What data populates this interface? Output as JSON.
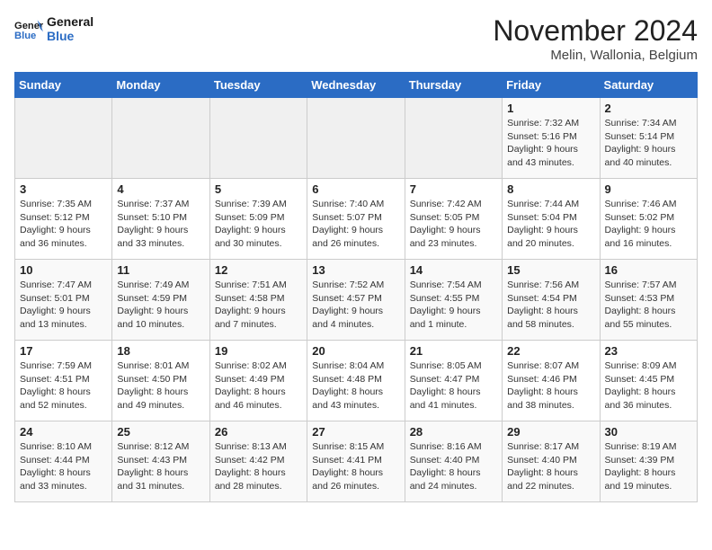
{
  "header": {
    "logo_line1": "General",
    "logo_line2": "Blue",
    "month_title": "November 2024",
    "location": "Melin, Wallonia, Belgium"
  },
  "weekdays": [
    "Sunday",
    "Monday",
    "Tuesday",
    "Wednesday",
    "Thursday",
    "Friday",
    "Saturday"
  ],
  "weeks": [
    [
      {
        "day": "",
        "info": ""
      },
      {
        "day": "",
        "info": ""
      },
      {
        "day": "",
        "info": ""
      },
      {
        "day": "",
        "info": ""
      },
      {
        "day": "",
        "info": ""
      },
      {
        "day": "1",
        "info": "Sunrise: 7:32 AM\nSunset: 5:16 PM\nDaylight: 9 hours and 43 minutes."
      },
      {
        "day": "2",
        "info": "Sunrise: 7:34 AM\nSunset: 5:14 PM\nDaylight: 9 hours and 40 minutes."
      }
    ],
    [
      {
        "day": "3",
        "info": "Sunrise: 7:35 AM\nSunset: 5:12 PM\nDaylight: 9 hours and 36 minutes."
      },
      {
        "day": "4",
        "info": "Sunrise: 7:37 AM\nSunset: 5:10 PM\nDaylight: 9 hours and 33 minutes."
      },
      {
        "day": "5",
        "info": "Sunrise: 7:39 AM\nSunset: 5:09 PM\nDaylight: 9 hours and 30 minutes."
      },
      {
        "day": "6",
        "info": "Sunrise: 7:40 AM\nSunset: 5:07 PM\nDaylight: 9 hours and 26 minutes."
      },
      {
        "day": "7",
        "info": "Sunrise: 7:42 AM\nSunset: 5:05 PM\nDaylight: 9 hours and 23 minutes."
      },
      {
        "day": "8",
        "info": "Sunrise: 7:44 AM\nSunset: 5:04 PM\nDaylight: 9 hours and 20 minutes."
      },
      {
        "day": "9",
        "info": "Sunrise: 7:46 AM\nSunset: 5:02 PM\nDaylight: 9 hours and 16 minutes."
      }
    ],
    [
      {
        "day": "10",
        "info": "Sunrise: 7:47 AM\nSunset: 5:01 PM\nDaylight: 9 hours and 13 minutes."
      },
      {
        "day": "11",
        "info": "Sunrise: 7:49 AM\nSunset: 4:59 PM\nDaylight: 9 hours and 10 minutes."
      },
      {
        "day": "12",
        "info": "Sunrise: 7:51 AM\nSunset: 4:58 PM\nDaylight: 9 hours and 7 minutes."
      },
      {
        "day": "13",
        "info": "Sunrise: 7:52 AM\nSunset: 4:57 PM\nDaylight: 9 hours and 4 minutes."
      },
      {
        "day": "14",
        "info": "Sunrise: 7:54 AM\nSunset: 4:55 PM\nDaylight: 9 hours and 1 minute."
      },
      {
        "day": "15",
        "info": "Sunrise: 7:56 AM\nSunset: 4:54 PM\nDaylight: 8 hours and 58 minutes."
      },
      {
        "day": "16",
        "info": "Sunrise: 7:57 AM\nSunset: 4:53 PM\nDaylight: 8 hours and 55 minutes."
      }
    ],
    [
      {
        "day": "17",
        "info": "Sunrise: 7:59 AM\nSunset: 4:51 PM\nDaylight: 8 hours and 52 minutes."
      },
      {
        "day": "18",
        "info": "Sunrise: 8:01 AM\nSunset: 4:50 PM\nDaylight: 8 hours and 49 minutes."
      },
      {
        "day": "19",
        "info": "Sunrise: 8:02 AM\nSunset: 4:49 PM\nDaylight: 8 hours and 46 minutes."
      },
      {
        "day": "20",
        "info": "Sunrise: 8:04 AM\nSunset: 4:48 PM\nDaylight: 8 hours and 43 minutes."
      },
      {
        "day": "21",
        "info": "Sunrise: 8:05 AM\nSunset: 4:47 PM\nDaylight: 8 hours and 41 minutes."
      },
      {
        "day": "22",
        "info": "Sunrise: 8:07 AM\nSunset: 4:46 PM\nDaylight: 8 hours and 38 minutes."
      },
      {
        "day": "23",
        "info": "Sunrise: 8:09 AM\nSunset: 4:45 PM\nDaylight: 8 hours and 36 minutes."
      }
    ],
    [
      {
        "day": "24",
        "info": "Sunrise: 8:10 AM\nSunset: 4:44 PM\nDaylight: 8 hours and 33 minutes."
      },
      {
        "day": "25",
        "info": "Sunrise: 8:12 AM\nSunset: 4:43 PM\nDaylight: 8 hours and 31 minutes."
      },
      {
        "day": "26",
        "info": "Sunrise: 8:13 AM\nSunset: 4:42 PM\nDaylight: 8 hours and 28 minutes."
      },
      {
        "day": "27",
        "info": "Sunrise: 8:15 AM\nSunset: 4:41 PM\nDaylight: 8 hours and 26 minutes."
      },
      {
        "day": "28",
        "info": "Sunrise: 8:16 AM\nSunset: 4:40 PM\nDaylight: 8 hours and 24 minutes."
      },
      {
        "day": "29",
        "info": "Sunrise: 8:17 AM\nSunset: 4:40 PM\nDaylight: 8 hours and 22 minutes."
      },
      {
        "day": "30",
        "info": "Sunrise: 8:19 AM\nSunset: 4:39 PM\nDaylight: 8 hours and 19 minutes."
      }
    ]
  ]
}
